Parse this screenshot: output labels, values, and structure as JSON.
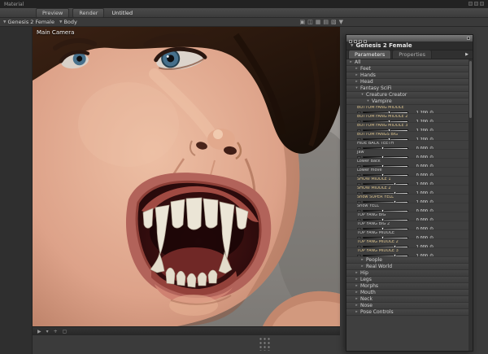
{
  "top_strip": {
    "label": "Material",
    "window_buttons": [
      "minimize-icon",
      "maximize-icon",
      "close-icon"
    ]
  },
  "menu_bar": {
    "preview": "Preview",
    "render": "Render",
    "title": "Untitled"
  },
  "node_bar": {
    "figure": "Genesis 2 Female",
    "part": "Body",
    "icons": [
      {
        "name": "layout-single-icon",
        "glyph": "▣"
      },
      {
        "name": "layout-split-icon",
        "glyph": "◫"
      },
      {
        "name": "layout-grid-icon",
        "glyph": "▦"
      },
      {
        "name": "layout-rows-icon",
        "glyph": "▤"
      },
      {
        "name": "aspect-frame-icon",
        "glyph": "▧"
      },
      {
        "name": "camera-menu-icon",
        "glyph": "▼"
      }
    ]
  },
  "viewport": {
    "camera": "Main Camera"
  },
  "viewport_toolbar": {
    "icons": [
      {
        "name": "cursor-tool-icon",
        "glyph": "▶"
      },
      {
        "name": "camera-dropdown-icon",
        "glyph": "▾"
      },
      {
        "name": "aim-tool-icon",
        "glyph": "+"
      },
      {
        "name": "frame-tool-icon",
        "glyph": "▢"
      }
    ]
  },
  "panel": {
    "title": "Genesis 2 Female",
    "titlebar_buttons": [
      "dock-grip-icon",
      "float-icon",
      "minimize-icon",
      "maximize-icon"
    ],
    "titlebar_right_button": "close-icon",
    "tabs": [
      {
        "label": "Parameters",
        "active": true
      },
      {
        "label": "Properties",
        "active": false
      }
    ],
    "rows": [
      {
        "type": "group",
        "label": "All",
        "indent": 0,
        "expanded": false
      },
      {
        "type": "group",
        "label": "Feet",
        "indent": 1,
        "expanded": false
      },
      {
        "type": "group",
        "label": "Hands",
        "indent": 1,
        "expanded": false
      },
      {
        "type": "group",
        "label": "Head",
        "indent": 1,
        "expanded": false
      },
      {
        "type": "group",
        "label": "Fantasy SciFi",
        "indent": 1,
        "expanded": true
      },
      {
        "type": "group",
        "label": "Creature Creator",
        "indent": 2,
        "expanded": true
      },
      {
        "type": "group",
        "label": "Vampire",
        "indent": 3,
        "expanded": true
      },
      {
        "type": "slider",
        "label": "BOTTOM FANG MIDDLE",
        "value": "1.200",
        "thumb_pct": 60,
        "modified": true
      },
      {
        "type": "slider",
        "label": "BOTTOM FANG MIDDLE 2",
        "value": "1.200",
        "thumb_pct": 60,
        "modified": true
      },
      {
        "type": "slider",
        "label": "BOTTOM FANG MIDDLE 3",
        "value": "1.200",
        "thumb_pct": 60,
        "modified": true
      },
      {
        "type": "slider",
        "label": "BOTTOM FANGS BIG",
        "value": "1.200",
        "thumb_pct": 60,
        "modified": true
      },
      {
        "type": "slider",
        "label": "HIDE BACK TEETH",
        "value": "0.000",
        "thumb_pct": 45,
        "modified": false
      },
      {
        "type": "slider",
        "label": "Jaw",
        "value": "0.000",
        "thumb_pct": 45,
        "modified": false
      },
      {
        "type": "slider",
        "label": "Lower Back",
        "value": "0.000",
        "thumb_pct": 45,
        "modified": false
      },
      {
        "type": "slider",
        "label": "Lower move",
        "value": "0.000",
        "thumb_pct": 45,
        "modified": false
      },
      {
        "type": "slider",
        "label": "SHOW MIDDLE 1",
        "value": "1.000",
        "thumb_pct": 72,
        "modified": true
      },
      {
        "type": "slider",
        "label": "SHOW MIDDLE 2",
        "value": "1.000",
        "thumb_pct": 72,
        "modified": true
      },
      {
        "type": "slider",
        "label": "Show SUPER YELL",
        "value": "1.000",
        "thumb_pct": 72,
        "modified": true
      },
      {
        "type": "slider",
        "label": "Show YELL",
        "value": "0.000",
        "thumb_pct": 45,
        "modified": false
      },
      {
        "type": "slider",
        "label": "TOP FANG BIG",
        "value": "0.000",
        "thumb_pct": 45,
        "modified": false
      },
      {
        "type": "slider",
        "label": "TOP FANG BIG 2",
        "value": "0.000",
        "thumb_pct": 45,
        "modified": false
      },
      {
        "type": "slider",
        "label": "TOP FANG MIDDLE",
        "value": "0.000",
        "thumb_pct": 45,
        "modified": false
      },
      {
        "type": "slider",
        "label": "TOP FANG MIDDLE 2",
        "value": "1.000",
        "thumb_pct": 72,
        "modified": true
      },
      {
        "type": "slider",
        "label": "TOP FANG MIDDLE 3",
        "value": "1.000",
        "thumb_pct": 72,
        "modified": true
      },
      {
        "type": "group",
        "label": "People",
        "indent": 2,
        "expanded": false
      },
      {
        "type": "group",
        "label": "Real World",
        "indent": 2,
        "expanded": false
      },
      {
        "type": "group",
        "label": "Hip",
        "indent": 1,
        "expanded": false
      },
      {
        "type": "group",
        "label": "Legs",
        "indent": 1,
        "expanded": false
      },
      {
        "type": "group",
        "label": "Morphs",
        "indent": 1,
        "expanded": false
      },
      {
        "type": "group",
        "label": "Mouth",
        "indent": 1,
        "expanded": false
      },
      {
        "type": "group",
        "label": "Neck",
        "indent": 1,
        "expanded": false
      },
      {
        "type": "group",
        "label": "Nose",
        "indent": 1,
        "expanded": false
      },
      {
        "type": "group",
        "label": "Pose Controls",
        "indent": 1,
        "expanded": false
      }
    ]
  },
  "colors": {
    "modified_label": "#d9c18c",
    "panel_bg": "#3e3e3e",
    "viewport_bg": "#8e8b88",
    "skin_tone": "#dda289",
    "mouth_interior": "#2a0a0b"
  }
}
